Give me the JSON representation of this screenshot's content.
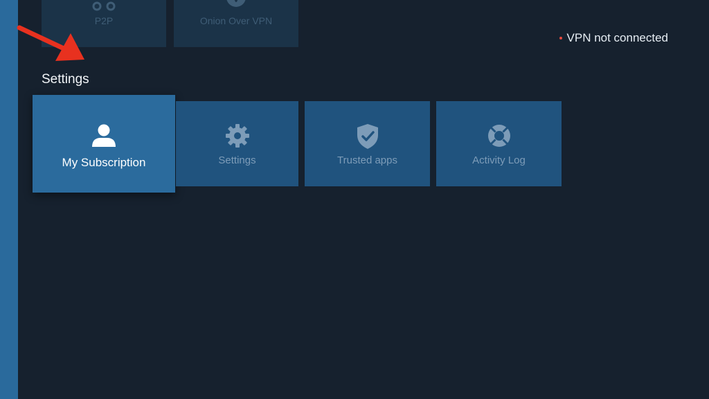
{
  "status": {
    "text": "VPN not connected",
    "dot_color": "#e5483d"
  },
  "top_row": [
    {
      "label": "P2P",
      "icon": "p2p-icon"
    },
    {
      "label": "Onion Over VPN",
      "icon": "onion-icon"
    }
  ],
  "section": {
    "title": "Settings"
  },
  "tiles": [
    {
      "label": "My Subscription",
      "icon": "user-icon",
      "focused": true
    },
    {
      "label": "Settings",
      "icon": "gear-icon"
    },
    {
      "label": "Trusted apps",
      "icon": "shield-check-icon"
    },
    {
      "label": "Activity Log",
      "icon": "lifebuoy-icon"
    }
  ],
  "colors": {
    "background": "#16212e",
    "sidebar": "#2a6a9c",
    "tile": "#20537e",
    "tile_focused": "#2b6b9d",
    "annotation_arrow": "#e8311f"
  }
}
